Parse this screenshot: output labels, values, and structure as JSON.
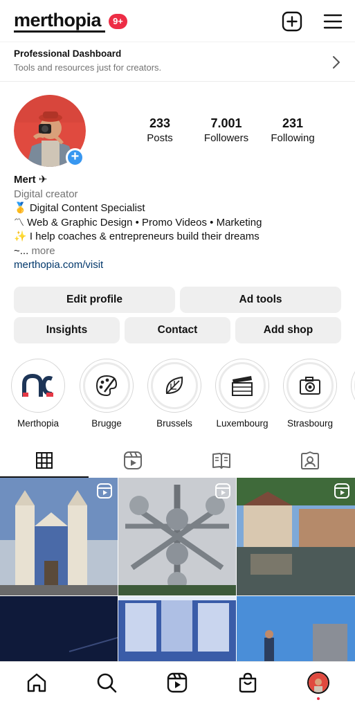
{
  "header": {
    "username": "merthopia",
    "notification_count": "9+",
    "icons": [
      "create-post-icon",
      "menu-icon"
    ]
  },
  "professional_dashboard": {
    "title": "Professional Dashboard",
    "subtitle": "Tools and resources just for creators."
  },
  "profile": {
    "stats": [
      {
        "value": "233",
        "label": "Posts"
      },
      {
        "value": "7.001",
        "label": "Followers"
      },
      {
        "value": "231",
        "label": "Following"
      }
    ],
    "name": "Mert ✈",
    "category": "Digital creator",
    "bio_lines": [
      "🥇 Digital Content Specialist",
      "〽 Web & Graphic Design • Promo Videos • Marketing",
      "✨ I help coaches & entrepreneurs build their dreams"
    ],
    "bio_truncated": "~...",
    "more_label": "more",
    "link": "merthopia.com/visit"
  },
  "buttons": {
    "edit_profile": "Edit profile",
    "ad_tools": "Ad tools",
    "insights": "Insights",
    "contact": "Contact",
    "add_shop": "Add shop"
  },
  "highlights": [
    {
      "label": "Merthopia",
      "icon": "merthopia-logo"
    },
    {
      "label": "Brugge",
      "icon": "palette-icon"
    },
    {
      "label": "Brussels",
      "icon": "leaf-icon"
    },
    {
      "label": "Luxembourg",
      "icon": "clapperboard-icon"
    },
    {
      "label": "Strasbourg",
      "icon": "camera-icon"
    }
  ],
  "tabs": [
    "grid-icon",
    "reels-icon",
    "guides-icon",
    "tagged-icon"
  ],
  "grid_posts": [
    {
      "scene": "church with blue azulejo tiles",
      "is_reel": true
    },
    {
      "scene": "atomium",
      "is_reel": true
    },
    {
      "scene": "strasbourg canal houses",
      "is_reel": true
    },
    {
      "scene": "night sky",
      "is_reel": false
    },
    {
      "scene": "azulejo tile wall",
      "is_reel": false
    },
    {
      "scene": "castle blue sky",
      "is_reel": false
    }
  ],
  "bottom_nav": [
    "home-icon",
    "search-icon",
    "reels-icon",
    "shop-icon",
    "profile-avatar"
  ],
  "colors": {
    "badge": "#ed2d45",
    "link": "#00376b",
    "add_story": "#3897f0",
    "button_bg": "#efefef"
  }
}
